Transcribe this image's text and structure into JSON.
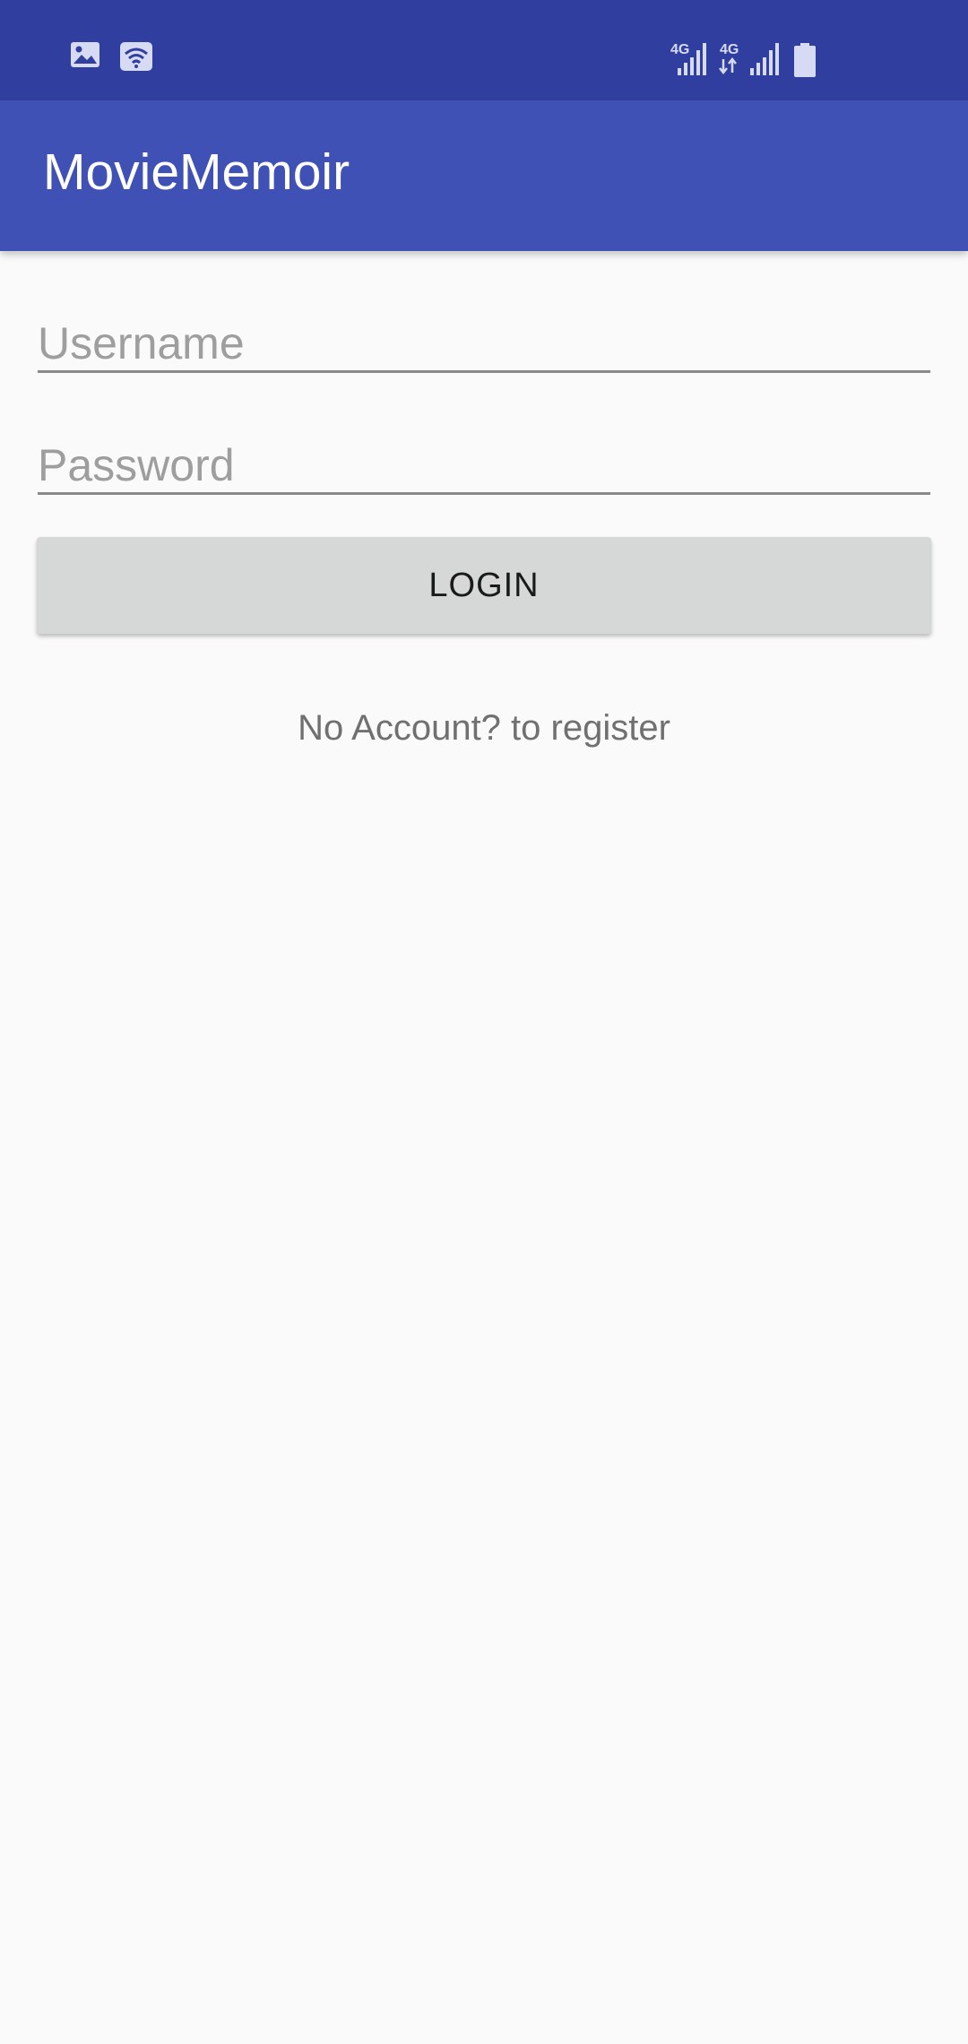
{
  "status_bar": {
    "left_icons": [
      "gallery-icon",
      "wifi-icon"
    ],
    "right_icons": [
      "signal-4g-icon",
      "signal-4g-data-icon",
      "battery-icon"
    ],
    "sim1_label": "4G",
    "sim2_label": "4G",
    "icon_color": "#d6daf2"
  },
  "app_bar": {
    "title": "MovieMemoir",
    "background": "#3f51b5"
  },
  "form": {
    "username_placeholder": "Username",
    "username_value": "",
    "password_placeholder": "Password",
    "password_value": "",
    "login_label": "LOGIN",
    "register_text": "No Account? to register"
  },
  "colors": {
    "status_bar": "#303f9f",
    "primary": "#3f51b5",
    "background": "#fafafa",
    "button": "#d6d7d7"
  }
}
